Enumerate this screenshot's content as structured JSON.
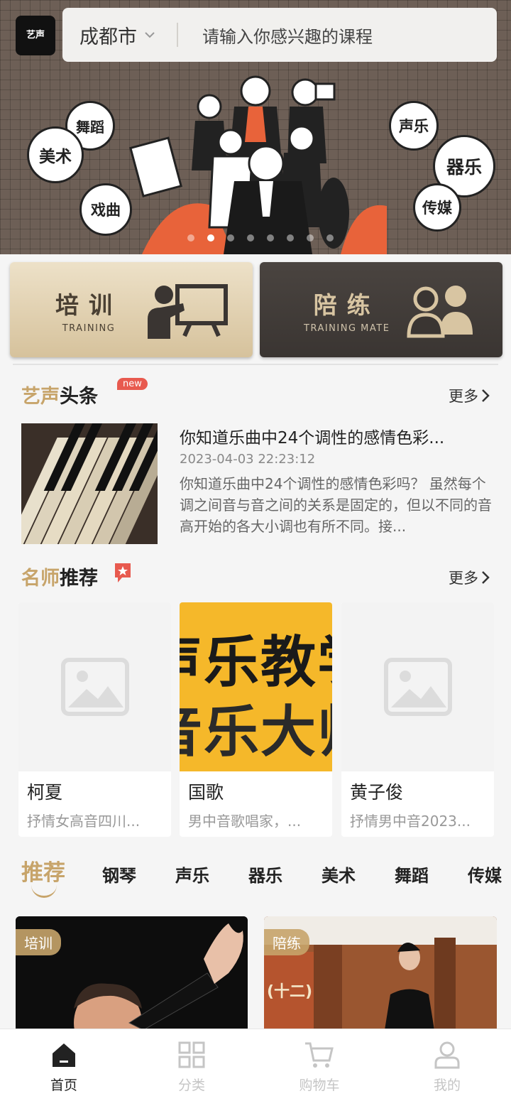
{
  "header": {
    "logo_text": "艺声",
    "city": "成都市",
    "search_placeholder": "请输入你感兴趣的课程"
  },
  "banner": {
    "bubbles": [
      "舞蹈",
      "美术",
      "戏曲",
      "声乐",
      "器乐",
      "传媒"
    ],
    "slide_count": 8,
    "active_slide": 1
  },
  "entries": [
    {
      "title": "培训",
      "subtitle": "TRAINING"
    },
    {
      "title": "陪练",
      "subtitle": "TRAINING MATE"
    }
  ],
  "headline": {
    "title_accent": "艺声",
    "title_rest": "头条",
    "badge": "new",
    "more": "更多",
    "article": {
      "title": "你知道乐曲中24个调性的感情色彩...",
      "date": "2023-04-03 22:23:12",
      "desc": "你知道乐曲中24个调性的感情色彩吗？ 虽然每个调之间音与音之间的关系是固定的，但以不同的音高开始的各大小调也有所不同。接..."
    }
  },
  "teachers": {
    "title_accent": "名师",
    "title_rest": "推荐",
    "more": "更多",
    "items": [
      {
        "name": "柯夏",
        "desc": "抒情女高音四川..."
      },
      {
        "name": "国歌",
        "desc": "男中音歌唱家，...",
        "poster_line1": "声乐教学",
        "poster_line2": "音乐大师"
      },
      {
        "name": "黄子俊",
        "desc": "抒情男中音2023..."
      }
    ]
  },
  "category_tabs": [
    "推荐",
    "钢琴",
    "声乐",
    "器乐",
    "美术",
    "舞蹈",
    "传媒"
  ],
  "recommend": {
    "cards": [
      {
        "tag": "培训"
      },
      {
        "tag": "陪练",
        "banner_text": "(十二)"
      }
    ]
  },
  "tabbar": {
    "items": [
      {
        "label": "首页",
        "icon": "home-icon"
      },
      {
        "label": "分类",
        "icon": "category-icon"
      },
      {
        "label": "购物车",
        "icon": "cart-icon"
      },
      {
        "label": "我的",
        "icon": "user-icon"
      }
    ]
  },
  "colors": {
    "accent": "#c7a46a",
    "badge_red": "#e85a4f"
  }
}
